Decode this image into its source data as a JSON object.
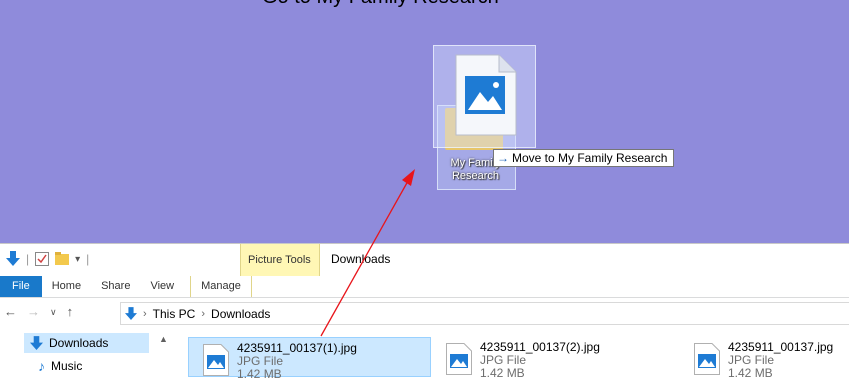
{
  "desktop": {
    "top_caption": "Go to My Family Research",
    "folder_label": "My Family Research",
    "drag_tooltip": "Move to My Family Research",
    "tooltip_icon": "move-arrow-icon",
    "background_color": "#8f8bdb"
  },
  "explorer": {
    "title": "Downloads",
    "contextual_tab": "Picture Tools",
    "ribbon_tabs": [
      "File",
      "Home",
      "Share",
      "View",
      "Manage"
    ],
    "breadcrumb": [
      "This PC",
      "Downloads"
    ],
    "nav_pane": [
      {
        "label": "Downloads",
        "icon": "download-arrow-icon",
        "selected": true
      },
      {
        "label": "Music",
        "icon": "music-note-icon",
        "selected": false
      }
    ],
    "files": [
      {
        "name": "4235911_00137(1).jpg",
        "type": "JPG File",
        "size": "1.42 MB",
        "selected": true
      },
      {
        "name": "4235911_00137(2).jpg",
        "type": "JPG File",
        "size": "1.42 MB",
        "selected": false
      },
      {
        "name": "4235911_00137.jpg",
        "type": "JPG File",
        "size": "1.42 MB",
        "selected": false
      }
    ]
  },
  "annotation": {
    "arrow_color": "#e8151b"
  }
}
